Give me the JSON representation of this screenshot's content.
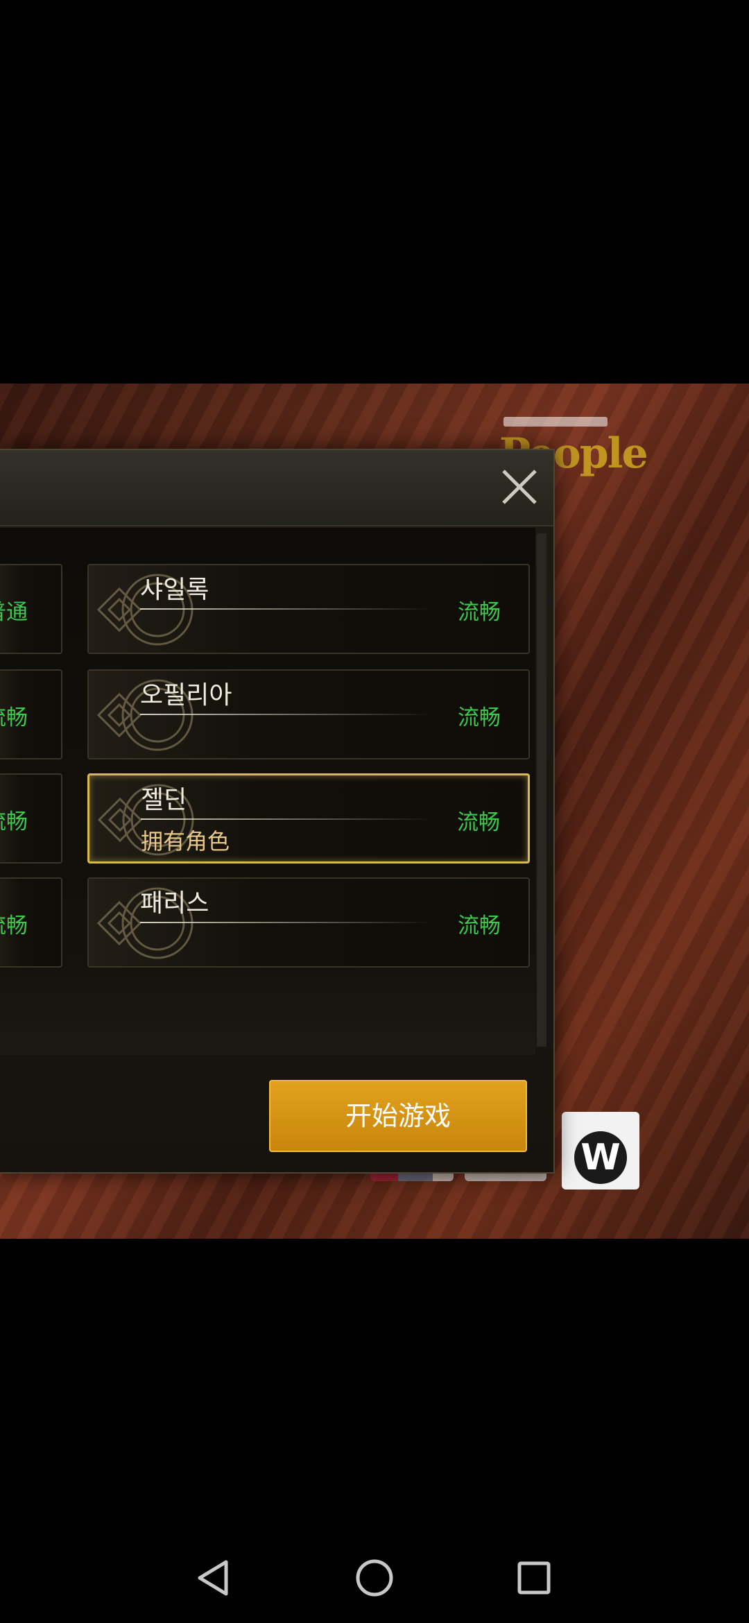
{
  "dialog": {
    "close_label": "×",
    "servers_left": [
      {
        "status": "普通"
      },
      {
        "status": "流畅"
      },
      {
        "status": "流畅"
      },
      {
        "status": "流畅"
      }
    ],
    "servers_right": [
      {
        "name": "샤일록",
        "sub": "",
        "status": "流畅"
      },
      {
        "name": "오필리아",
        "sub": "",
        "status": "流畅"
      },
      {
        "name": "젤딘",
        "sub": "拥有角色",
        "status": "流畅",
        "selected": true
      },
      {
        "name": "패리스",
        "sub": "",
        "status": "流畅"
      }
    ],
    "start_button": "开始游戏"
  },
  "background": {
    "logo_text": "People",
    "rating_badge_letter": "W"
  },
  "colors": {
    "status_green": "#3cc84a",
    "start_button": "#d08e12",
    "selected_border": "#d8b850"
  },
  "nav": {
    "back": "back-icon",
    "home": "home-icon",
    "recents": "recents-icon"
  }
}
